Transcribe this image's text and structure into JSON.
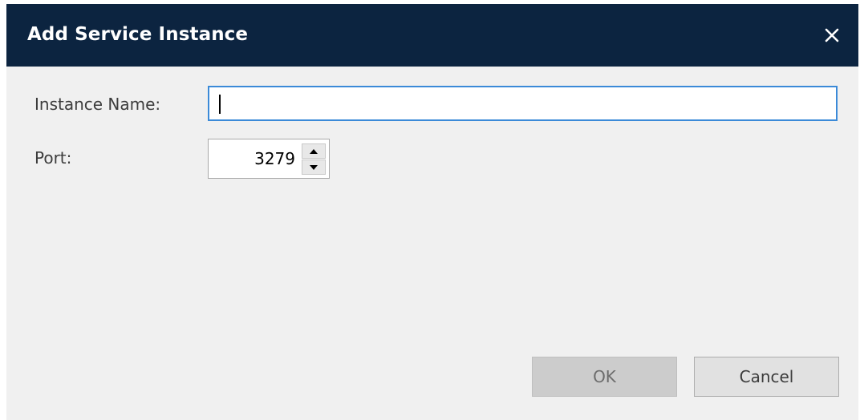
{
  "dialog": {
    "title": "Add Service Instance",
    "close_icon": "close-icon"
  },
  "form": {
    "instance_name_label": "Instance Name:",
    "instance_name_value": "",
    "port_label": "Port:",
    "port_value": "3279",
    "spin_up_icon": "arrow-up-icon",
    "spin_down_icon": "arrow-down-icon"
  },
  "buttons": {
    "ok_label": "OK",
    "cancel_label": "Cancel"
  },
  "colors": {
    "titlebar": "#0c2440",
    "focus_border": "#3b8ad8",
    "dialog_background": "#f0f0f0"
  }
}
